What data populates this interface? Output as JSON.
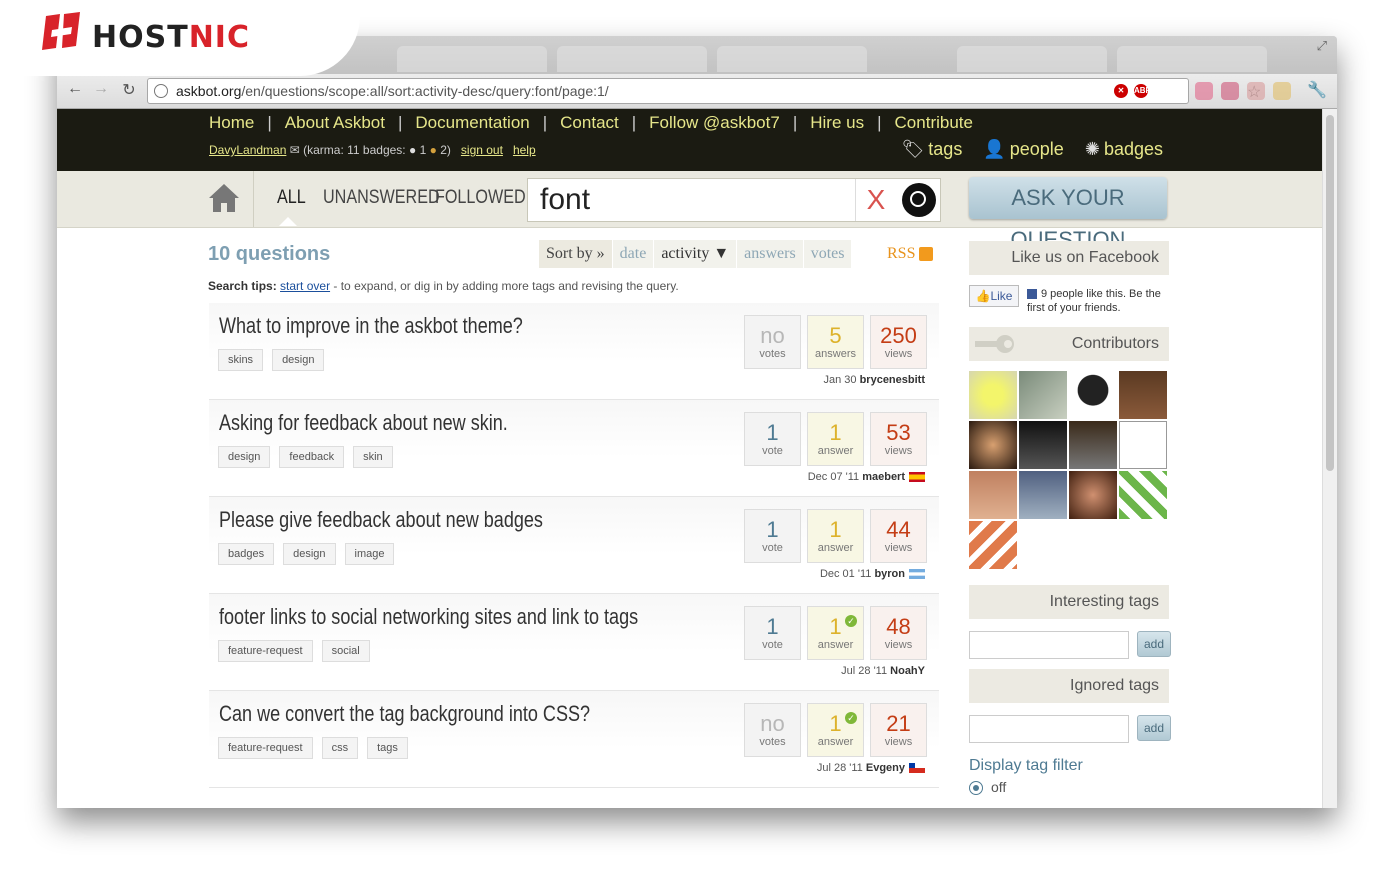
{
  "brand": {
    "logo_text_dark": "HOST",
    "logo_text_red": "NIC",
    "red": "#d8232a"
  },
  "browser": {
    "url_host": "askbot.org",
    "url_path": "/en/questions/scope:all/sort:activity-desc/query:font/page:1/",
    "back_icon": "arrow-left-icon",
    "forward_icon": "arrow-right-icon",
    "reload_icon": "reload-icon",
    "star_icon": "star-icon",
    "wrench_icon": "wrench-icon",
    "abp_label": "ABP"
  },
  "topnav": {
    "items": [
      "Home",
      "About Askbot",
      "Documentation",
      "Contact",
      "Follow @askbot7",
      "Hire us",
      "Contribute"
    ],
    "separator": "|"
  },
  "user": {
    "name": "DavyLandman",
    "karma_text": "(karma: 11 badges:",
    "silver": "1",
    "bronze": "2",
    "close": ")",
    "signout": "sign out",
    "help": "help"
  },
  "header_links": {
    "tags": "tags",
    "people": "people",
    "badges": "badges"
  },
  "scopes": {
    "all": "ALL",
    "unanswered": "UNANSWERED",
    "followed": "FOLLOWED"
  },
  "search": {
    "value": "font",
    "clear": "X"
  },
  "ask_button": "ASK YOUR QUESTION",
  "question_count": "10 questions",
  "sort": {
    "label": "Sort by »",
    "date": "date",
    "activity": "activity ▼",
    "answers": "answers",
    "votes": "votes"
  },
  "rss": "RSS",
  "search_tips": {
    "label": "Search tips:",
    "link": "start over",
    "rest": " - to expand, or dig in by adding more tags and revising the query."
  },
  "questions": [
    {
      "title": "What to improve in the askbot theme?",
      "tags": [
        "skins",
        "design"
      ],
      "votes": "no",
      "votes_label": "votes",
      "answers": "5",
      "answers_label": "answers",
      "views": "250",
      "views_label": "views",
      "date": "Jan 30",
      "user": "brycenesbitt",
      "accepted": false
    },
    {
      "title": "Asking for feedback about new skin.",
      "tags": [
        "design",
        "feedback",
        "skin"
      ],
      "votes": "1",
      "votes_label": "vote",
      "answers": "1",
      "answers_label": "answer",
      "views": "53",
      "views_label": "views",
      "date": "Dec 07 '11",
      "user": "maebert",
      "accepted": false
    },
    {
      "title": "Please give feedback about new badges",
      "tags": [
        "badges",
        "design",
        "image"
      ],
      "votes": "1",
      "votes_label": "vote",
      "answers": "1",
      "answers_label": "answer",
      "views": "44",
      "views_label": "views",
      "date": "Dec 01 '11",
      "user": "byron",
      "accepted": false
    },
    {
      "title": "footer links to social networking sites and link to tags",
      "tags": [
        "feature-request",
        "social"
      ],
      "votes": "1",
      "votes_label": "vote",
      "answers": "1",
      "answers_label": "answer",
      "views": "48",
      "views_label": "views",
      "date": "Jul 28 '11",
      "user": "NoahY",
      "accepted": true
    },
    {
      "title": "Can we convert the tag background into CSS?",
      "tags": [
        "feature-request",
        "css",
        "tags"
      ],
      "votes": "no",
      "votes_label": "votes",
      "answers": "1",
      "answers_label": "answer",
      "views": "21",
      "views_label": "views",
      "date": "Jul 28 '11",
      "user": "Evgeny",
      "accepted": true
    }
  ],
  "sidebar": {
    "facebook_title": "Like us on Facebook",
    "like_label": "Like",
    "fb_text": "9 people like this. Be the first of your friends.",
    "contributors_title": "Contributors",
    "interesting_title": "Interesting tags",
    "ignored_title": "Ignored tags",
    "add_label": "add",
    "display_filter": "Display tag filter",
    "off_label": "off"
  }
}
